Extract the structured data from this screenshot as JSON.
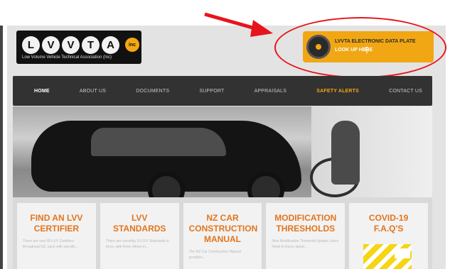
{
  "logo": {
    "letters": [
      "L",
      "V",
      "V",
      "T",
      "A"
    ],
    "badge": "inc",
    "tagline": "Low Volume Vehicle Technical Association (Inc)"
  },
  "data_plate": {
    "title": "LVVTA ELECTRONIC DATA PLATE",
    "subtitle": "LOOK UP HERE",
    "icon": "search-icon",
    "accent": "#f1a713"
  },
  "annotation": {
    "highlight_color": "#e8141b"
  },
  "nav": {
    "items": [
      {
        "label": "HOME",
        "state": "active"
      },
      {
        "label": "ABOUT US",
        "state": ""
      },
      {
        "label": "DOCUMENTS",
        "state": ""
      },
      {
        "label": "SUPPORT",
        "state": ""
      },
      {
        "label": "APPRAISALS",
        "state": ""
      },
      {
        "label": "SAFETY ALERTS",
        "state": "alert"
      },
      {
        "label": "CONTACT US",
        "state": ""
      }
    ]
  },
  "cards": [
    {
      "title": "FIND AN LVV CERTIFIER",
      "blurb": "There are over 80 LVV Certifiers throughout NZ, each with specific..."
    },
    {
      "title": "LVV STANDARDS",
      "blurb": "There are currently 10 LVV Standards in force, with three others in..."
    },
    {
      "title": "NZ CAR CONSTRUCTION MANUAL",
      "blurb": "The NZ Car Construction Manual provides..."
    },
    {
      "title": "MODIFICATION THRESHOLDS",
      "blurb": "New Modification Threshold Update Users Need to Know about..."
    },
    {
      "title": "COVID-19 F.A.Q'S",
      "blurb": "",
      "image": "covid-19 warning sign image"
    }
  ]
}
